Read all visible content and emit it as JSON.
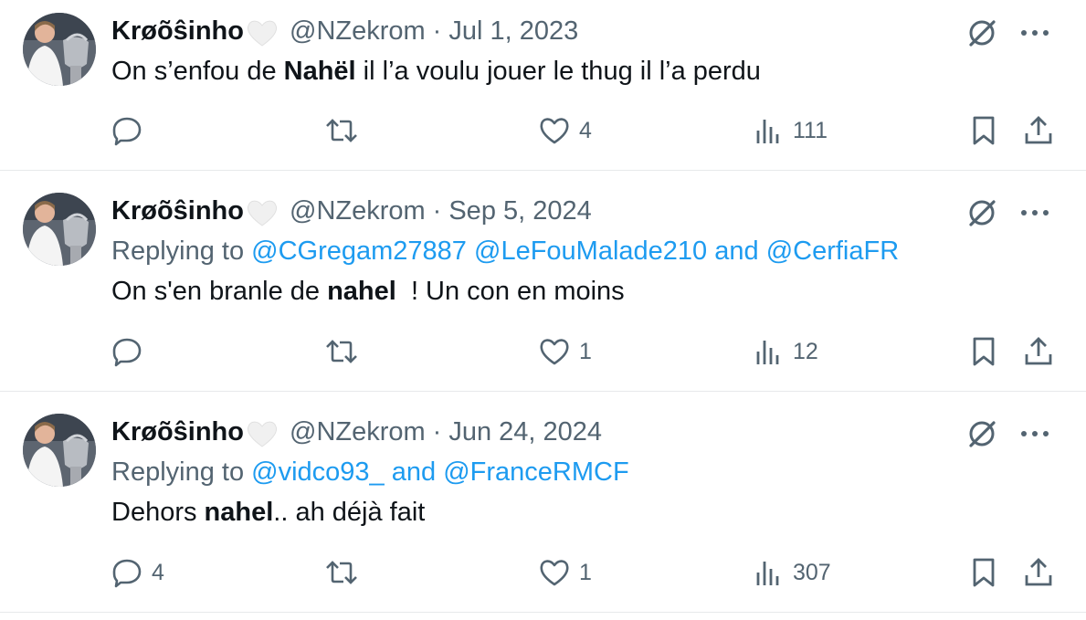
{
  "colors": {
    "text": "#0f1419",
    "secondary": "#536471",
    "link": "#1d9bf0",
    "divider": "#e7e9eb"
  },
  "tweets": [
    {
      "display_name": "Krøõŝinho",
      "handle": "@NZekrom",
      "separator": "·",
      "date": "Jul 1, 2023",
      "replying_prefix": "",
      "mentions": [],
      "mention_joiner": "",
      "text_before": "On s’enfou de ",
      "text_bold": "Nahël",
      "text_after": " il l’a voulu jouer le thug il l’a perdu",
      "counts": {
        "reply": "",
        "retweet": "",
        "like": "4",
        "views": "111"
      }
    },
    {
      "display_name": "Krøõŝinho",
      "handle": "@NZekrom",
      "separator": "·",
      "date": "Sep 5, 2024",
      "replying_prefix": "Replying to",
      "mentions": [
        "@CGregam27887",
        "@LeFouMalade210",
        "and",
        "@CerfiaFR"
      ],
      "text_before": "On s'en branle de ",
      "text_bold": "nahel",
      "text_after": "  ! Un con en moins",
      "counts": {
        "reply": "",
        "retweet": "",
        "like": "1",
        "views": "12"
      }
    },
    {
      "display_name": "Krøõŝinho",
      "handle": "@NZekrom",
      "separator": "·",
      "date": "Jun 24, 2024",
      "replying_prefix": "Replying to",
      "mentions": [
        "@vidco93_",
        "and",
        "@FranceRMCF"
      ],
      "text_before": "Dehors ",
      "text_bold": "nahel",
      "text_after": ".. ah déjà fait",
      "counts": {
        "reply": "4",
        "retweet": "",
        "like": "1",
        "views": "307"
      }
    }
  ],
  "icons": {
    "badge": "white-heart-icon",
    "grok": "grok-icon",
    "more": "more-icon",
    "reply": "reply-icon",
    "retweet": "retweet-icon",
    "like": "heart-icon",
    "views": "views-icon",
    "bookmark": "bookmark-icon",
    "share": "share-icon"
  }
}
